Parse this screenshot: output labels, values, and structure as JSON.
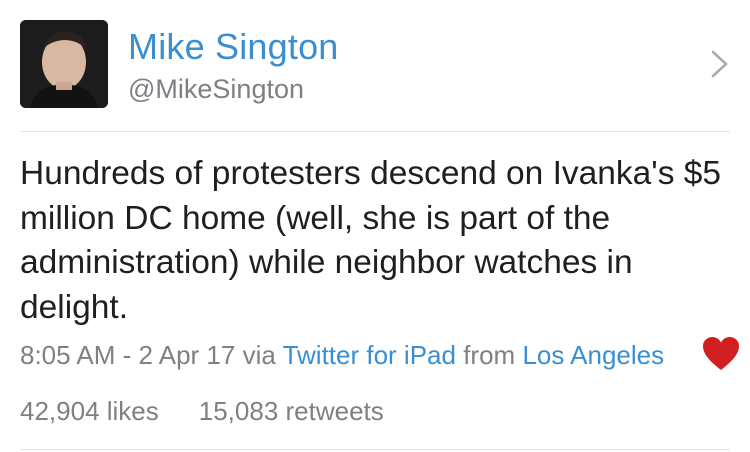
{
  "profile": {
    "name": "Mike Sington",
    "handle": "@MikeSington"
  },
  "tweet": {
    "text": "Hundreds of protesters descend on Ivanka's $5 million DC home (well, she is part of the administration) while neighbor watches in delight.",
    "time": "8:05 AM - 2 Apr 17",
    "via_prefix": " via ",
    "source": "Twitter for iPad",
    "from_prefix": " from ",
    "location": "Los Angeles"
  },
  "stats": {
    "likes": "42,904 likes",
    "retweets": "15,083 retweets"
  },
  "colors": {
    "accent": "#3b8fd0",
    "muted": "#7e8085",
    "heart": "#d11f1f"
  },
  "icons": {
    "chevron": "chevron-right-icon",
    "heart": "heart-icon"
  }
}
